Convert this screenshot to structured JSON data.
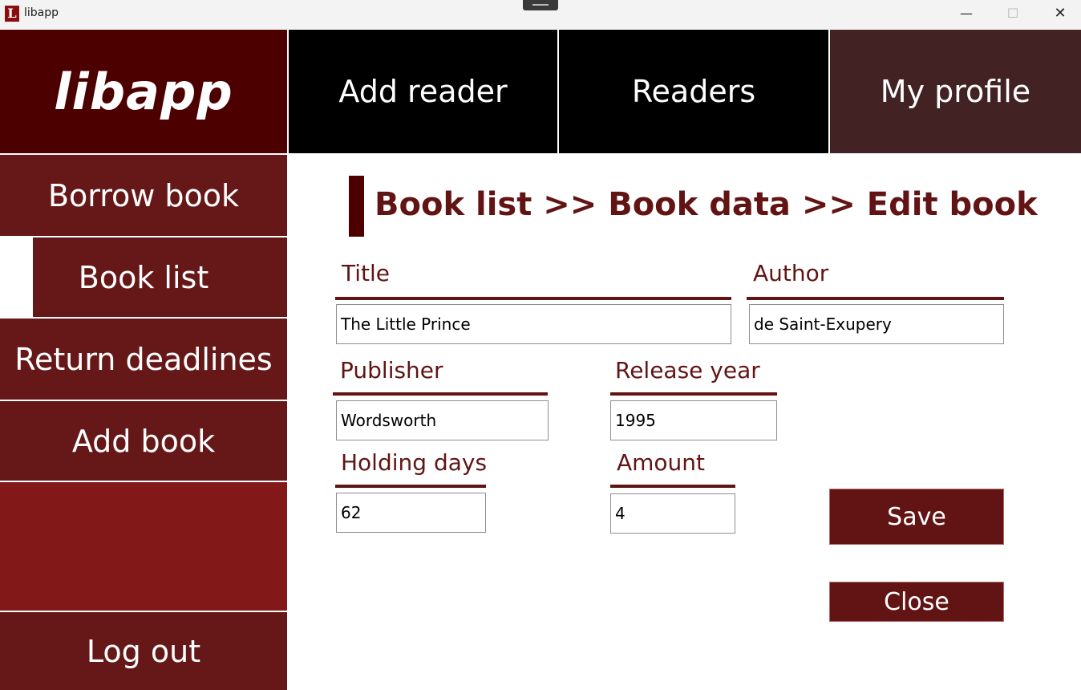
{
  "window": {
    "title": "libapp",
    "icon": "libapp-logo-icon",
    "controls": {
      "minimize": "—",
      "maximize": "☐",
      "close": "✕"
    }
  },
  "logo": {
    "text": "libapp"
  },
  "top_nav": [
    {
      "label": "Add reader"
    },
    {
      "label": "Readers"
    },
    {
      "label": "My profile"
    }
  ],
  "sidebar": {
    "items": [
      {
        "label": "Borrow book"
      },
      {
        "label": "Book list",
        "active": true
      },
      {
        "label": "Return deadlines"
      },
      {
        "label": "Add book"
      }
    ],
    "logout": "Log out"
  },
  "breadcrumb": "Book list >> Book data >> Edit book",
  "form": {
    "title": {
      "label": "Title",
      "value": "The Little Prince"
    },
    "author": {
      "label": "Author",
      "value": "de Saint-Exupery"
    },
    "publisher": {
      "label": "Publisher",
      "value": "Wordsworth"
    },
    "release_year": {
      "label": "Release year",
      "value": "1995"
    },
    "holding_days": {
      "label": "Holding days",
      "value": "62"
    },
    "amount": {
      "label": "Amount",
      "value": "4"
    }
  },
  "buttons": {
    "save": "Save",
    "close": "Close"
  },
  "colors": {
    "logo_bg": "#4c0000",
    "nav_bg": "#000000",
    "profile_bg": "#422222",
    "sidebar_bg": "#661818",
    "sidebar_empty_bg": "#821818",
    "accent_text": "#621414"
  }
}
